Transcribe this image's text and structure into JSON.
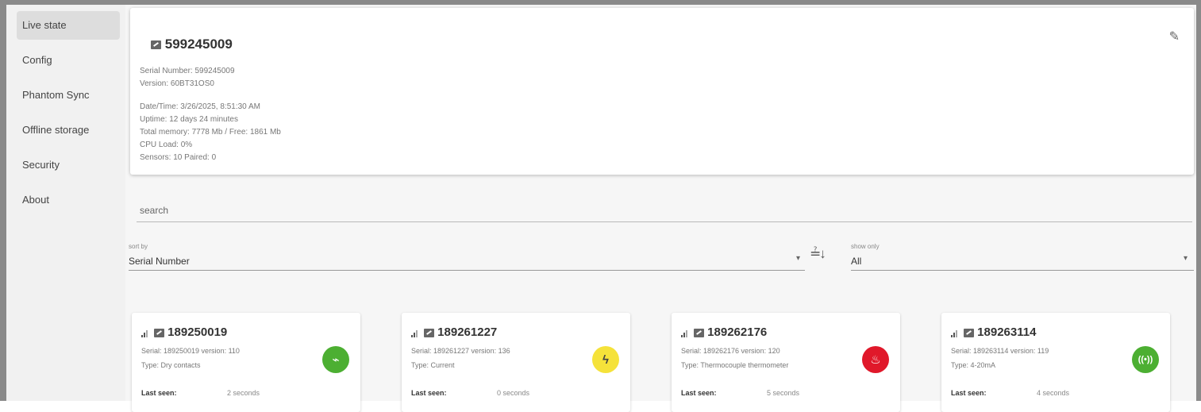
{
  "sidebar": {
    "items": [
      {
        "label": "Live state",
        "active": true
      },
      {
        "label": "Config"
      },
      {
        "label": "Phantom Sync"
      },
      {
        "label": "Offline storage"
      },
      {
        "label": "Security"
      },
      {
        "label": "About"
      }
    ]
  },
  "device": {
    "title": "599245009",
    "serial": "Serial Number: 599245009",
    "version": "Version: 60BT31OS0",
    "datetime": "Date/Time: 3/26/2025, 8:51:30 AM",
    "uptime": "Uptime: 12 days 24 minutes",
    "memory": "Total memory: 7778 Mb / Free: 1861 Mb",
    "cpu": "CPU Load: 0%",
    "sensors": "Sensors: 10 Paired: 0",
    "clean_icon": "broom-icon"
  },
  "filters": {
    "search_placeholder": "search",
    "sort_label": "sort by",
    "sort_value": "Serial Number",
    "show_label": "show only",
    "show_value": "All"
  },
  "sensors": [
    {
      "id": "189250019",
      "serial": "Serial: 189250019 version: 110",
      "type": "Type: Dry contacts",
      "seen_label": "Last seen:",
      "seen": "2 seconds",
      "icon": "dry-contacts-icon",
      "color": "#4caf32"
    },
    {
      "id": "189261227",
      "serial": "Serial: 189261227 version: 136",
      "type": "Type: Current",
      "seen_label": "Last seen:",
      "seen": "0 seconds",
      "icon": "current-icon",
      "color": "#f5e23a"
    },
    {
      "id": "189262176",
      "serial": "Serial: 189262176 version: 120",
      "type": "Type: Thermocouple thermometer",
      "seen_label": "Last seen:",
      "seen": "5 seconds",
      "icon": "thermometer-icon",
      "color": "#e0182a"
    },
    {
      "id": "189263114",
      "serial": "Serial: 189263114 version: 119",
      "type": "Type: 4-20mA",
      "seen_label": "Last seen:",
      "seen": "4 seconds",
      "icon": "analog-4-20ma-icon",
      "color": "#4caf32"
    }
  ]
}
